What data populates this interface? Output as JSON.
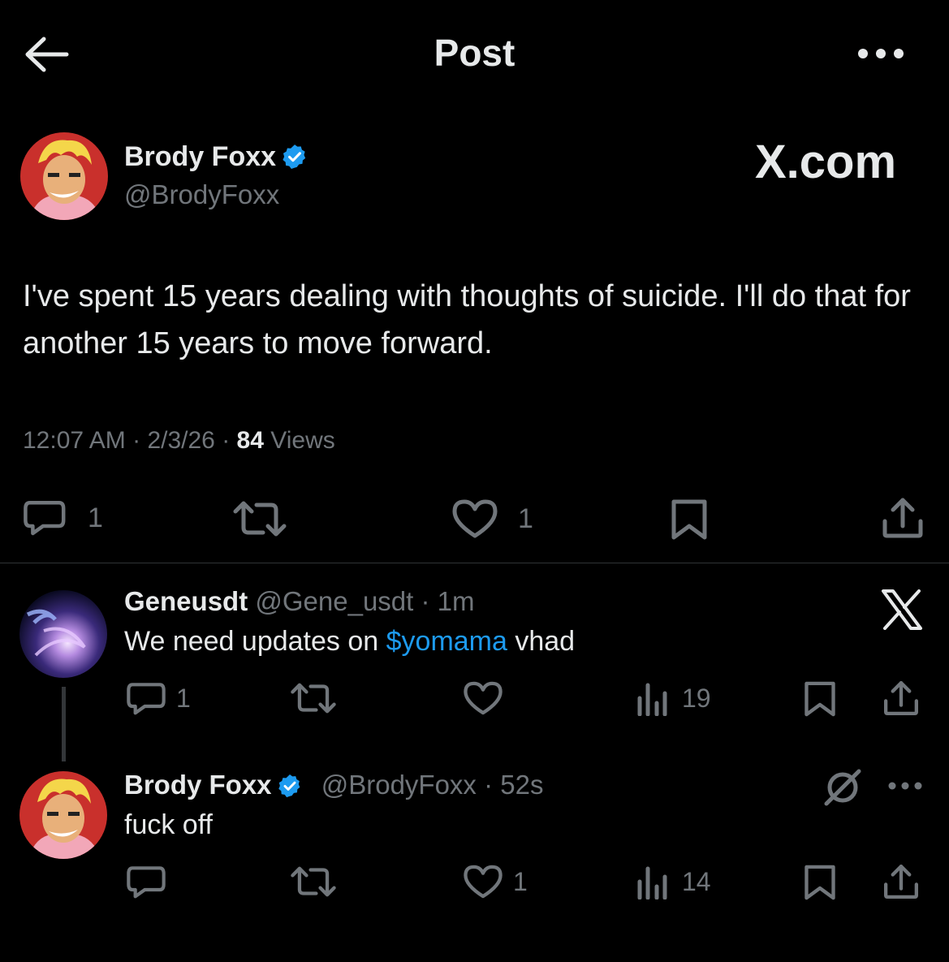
{
  "header": {
    "title": "Post"
  },
  "main_post": {
    "author_name": "Brody Foxx",
    "author_handle": "@BrodyFoxx",
    "watermark": "X.com",
    "text": "I've spent 15 years dealing with thoughts of suicide. I'll do that for another 15 years to move forward.",
    "time": "12:07 AM",
    "date": "2/3/26",
    "views_count": "84",
    "views_label": "Views",
    "replies": "1",
    "likes": "1"
  },
  "reply1": {
    "name": "Geneusdt",
    "handle": "@Gene_usdt",
    "age": "1m",
    "text_before": "We need updates on ",
    "cashtag": "$yomama",
    "text_after": " vhad",
    "replies": "1",
    "views": "19"
  },
  "reply2": {
    "name": "Brody Foxx",
    "handle": "@BrodyFoxx",
    "age": "52s",
    "text": "fuck off",
    "likes": "1",
    "views": "14"
  },
  "colors": {
    "background": "#000000",
    "text_primary": "#e7e9ea",
    "text_secondary": "#71767b",
    "accent": "#1d9bf0",
    "divider": "#2f3336"
  }
}
